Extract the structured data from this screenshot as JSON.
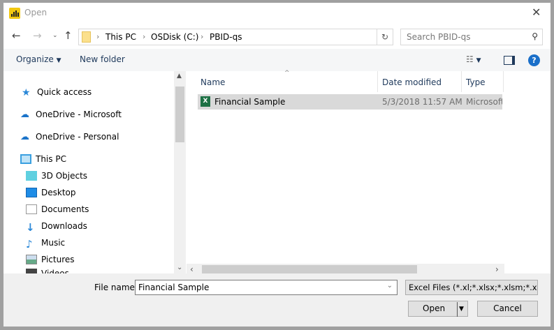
{
  "title": "Open",
  "address": {
    "crumbs": [
      "This PC",
      "OSDisk (C:)",
      "PBID-qs"
    ]
  },
  "search": {
    "placeholder": "Search PBID-qs"
  },
  "toolbar": {
    "organize": "Organize",
    "new_folder": "New folder",
    "help": "?"
  },
  "sidebar": {
    "items": [
      {
        "label": "Quick access",
        "icon": "star-icon"
      },
      {
        "label": "OneDrive - Microsoft",
        "icon": "onedrive-icon"
      },
      {
        "label": "OneDrive - Personal",
        "icon": "onedrive-icon"
      },
      {
        "label": "This PC",
        "icon": "monitor-icon"
      },
      {
        "label": "3D Objects",
        "icon": "cube-icon"
      },
      {
        "label": "Desktop",
        "icon": "desktop-icon"
      },
      {
        "label": "Documents",
        "icon": "document-icon"
      },
      {
        "label": "Downloads",
        "icon": "download-icon"
      },
      {
        "label": "Music",
        "icon": "music-icon"
      },
      {
        "label": "Pictures",
        "icon": "pictures-icon"
      },
      {
        "label": "Videos",
        "icon": "video-icon"
      }
    ]
  },
  "columns": {
    "name": "Name",
    "date": "Date modified",
    "type": "Type"
  },
  "files": [
    {
      "name": "Financial Sample",
      "date": "5/3/2018 11:57 AM",
      "type": "Microsoft"
    }
  ],
  "bottom": {
    "file_name_label": "File name:",
    "file_name_value": "Financial Sample",
    "filter": "Excel Files (*.xl;*.xlsx;*.xlsm;*.xls",
    "open": "Open",
    "cancel": "Cancel"
  },
  "colors": {
    "accent": "#1a6fc9",
    "selected_row": "#d9d9d9"
  }
}
